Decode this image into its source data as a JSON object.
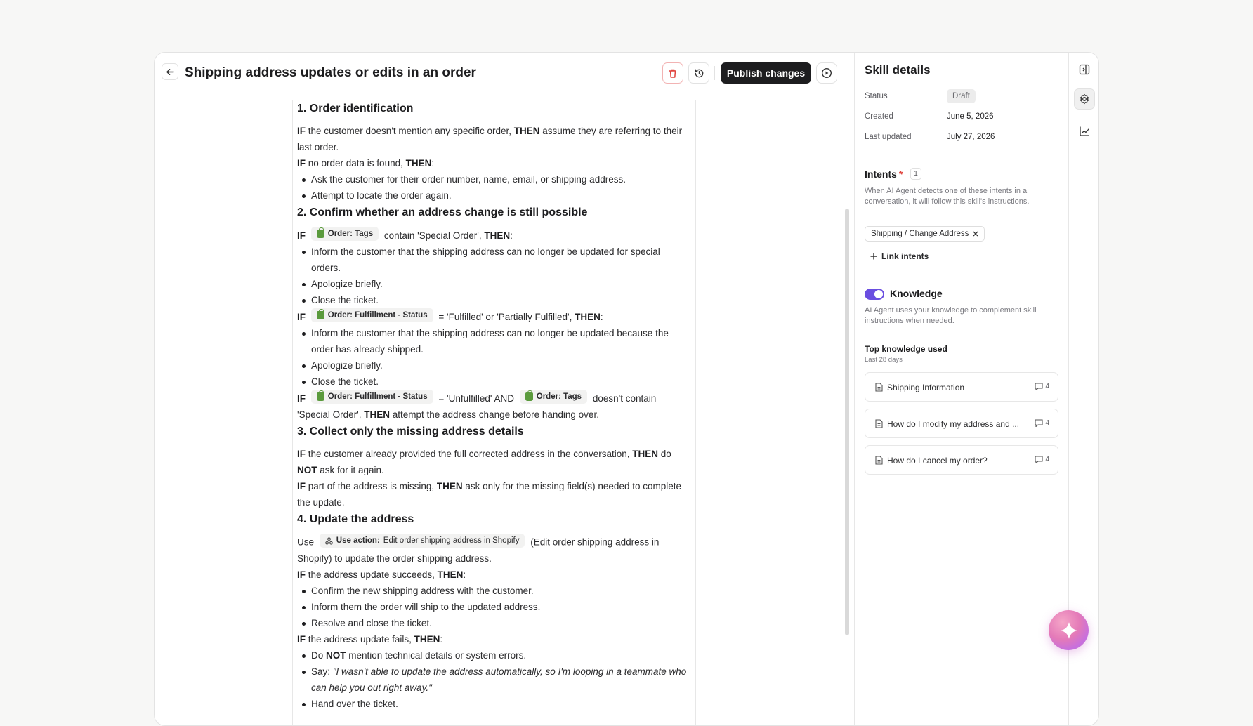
{
  "header": {
    "title": "Shipping address updates or edits in an order",
    "publish_label": "Publish changes"
  },
  "editor": {
    "s1": "1. Order identification",
    "s1_p1": [
      " the customer doesn't mention any specific order, ",
      " assume they are referring to their last order."
    ],
    "s1_p2": [
      " no order data is found, ",
      ":"
    ],
    "s1_b1": "Ask the customer for their order number, name, email, or shipping address.",
    "s1_b2": "Attempt to locate the order again.",
    "s2": "2. Confirm whether an address change is still possible",
    "if": "IF",
    "then": "THEN",
    "and_kw": "AND",
    "not_kw": "NOT",
    "chip_tags": "Order: Tags",
    "chip_fulfillment": "Order: Fulfillment - Status",
    "s2_p1_tail": "contain 'Special Order',",
    "s2_b1": "Inform the customer that the shipping address can no longer be updated for special orders.",
    "s2_b2": "Apologize briefly.",
    "s2_b3": "Close the ticket.",
    "s2_p2_tail": "= 'Fulfilled' or 'Partially Fulfilled',",
    "s2_b4": "Inform the customer that the shipping address can no longer be updated because the order has already shipped.",
    "s2_b5": "Apologize briefly.",
    "s2_b6": "Close the ticket.",
    "s2_p3_mid": "= 'Unfulfilled'",
    "s2_p3_tail1": "doesn't contain 'Special Order',",
    "s2_p3_tail2": "attempt the address change before handing over.",
    "s3": "3. Collect only the missing address details",
    "s3_p1_a": " the customer already provided the full corrected address in the conversation, ",
    "s3_p1_b": " do ",
    "s3_p1_c": " ask for it again.",
    "s3_p2_a": " part of the address is missing, ",
    "s3_p2_b": " ask only for the missing field(s) needed to complete the update.",
    "s4": "4. Update the address",
    "use": "Use",
    "action_label": "Use action:",
    "action_name": "Edit order shipping address in Shopify",
    "s4_p1_tail": "(Edit order shipping address in Shopify) to update the order shipping address.",
    "s4_p2": " the address update succeeds, ",
    "s4_b1": "Confirm the new shipping address with the customer.",
    "s4_b2": "Inform them the order will ship to the updated address.",
    "s4_b3": "Resolve and close the ticket.",
    "s4_p3": " the address update fails, ",
    "s4_b4_a": "Do ",
    "s4_b4_b": " mention technical details or system errors.",
    "s4_b5_a": "Say: ",
    "s4_b5_q": "\"I wasn't able to update the address automatically, so I'm looping in a teammate who can help you out right away.\"",
    "s4_b6": "Hand over the ticket."
  },
  "panel": {
    "title": "Skill details",
    "status_label": "Status",
    "status_value": "Draft",
    "created_label": "Created",
    "created_value": "June 5, 2026",
    "updated_label": "Last updated",
    "updated_value": "July 27, 2026",
    "intents_title": "Intents",
    "intents_required": "*",
    "intents_count": "1",
    "intents_desc": "When AI Agent detects one of these intents in a conversation, it will follow this skill's instructions.",
    "intent_chip": "Shipping / Change Address",
    "link_intents": "Link intents",
    "knowledge_title": "Knowledge",
    "knowledge_desc": "AI Agent uses your knowledge to complement skill instructions when needed.",
    "top_knowledge": "Top knowledge used",
    "top_knowledge_sub": "Last 28 days",
    "knowledge_items": [
      {
        "name": "Shipping Information",
        "count": "4"
      },
      {
        "name": "How do I modify my address and ...",
        "count": "4"
      },
      {
        "name": "How do I cancel my order?",
        "count": "4"
      }
    ]
  },
  "colors": {
    "accent": "#6a4ee0",
    "danger": "#e0443e",
    "primary_button": "#1d1d1f"
  }
}
